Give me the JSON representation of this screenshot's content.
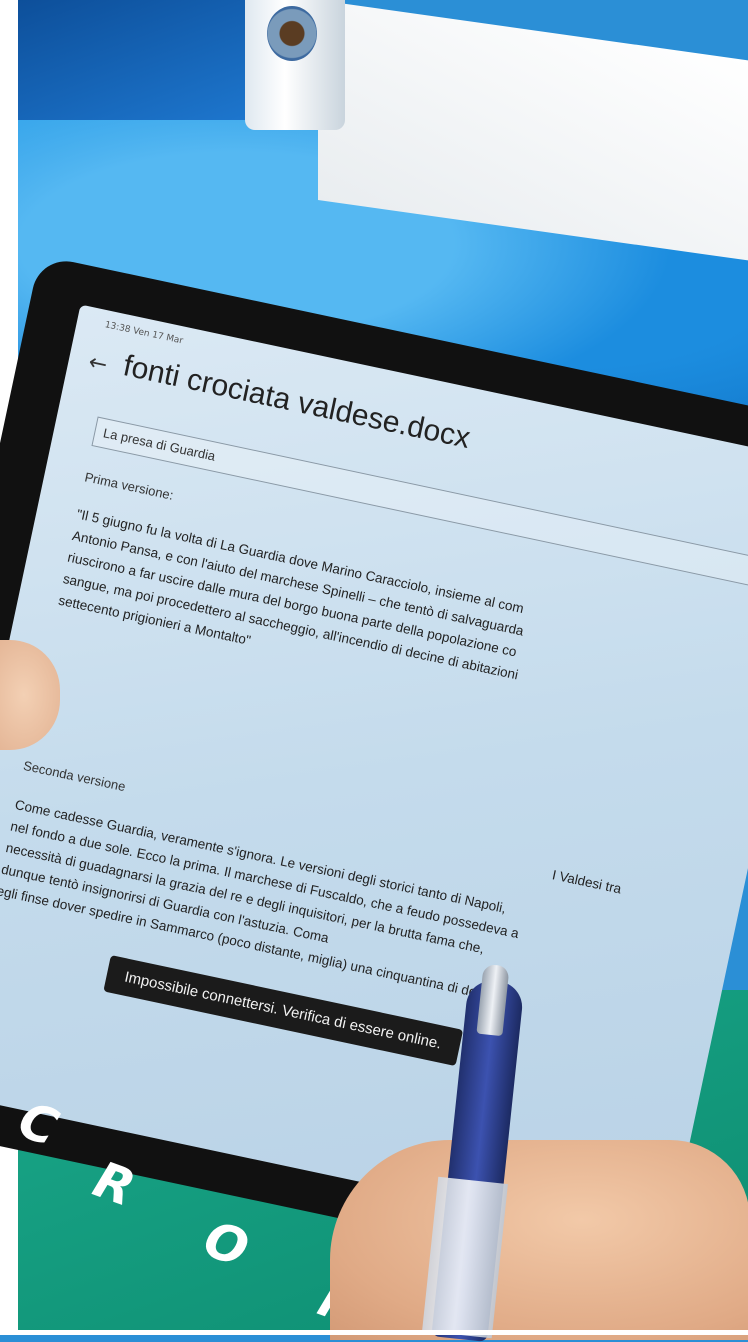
{
  "status_bar": "13:38 Ven 17 Mar",
  "document": {
    "title": "fonti crociata valdese.docx",
    "heading": "La presa di Guardia",
    "first_version_label": "Prima versione:",
    "first_version_lines": [
      "\"Il 5 giugno fu la volta di La Guardia dove Marino Caracciolo, insieme al com",
      "Antonio Pansa, e con l'aiuto del marchese Spinelli – che tentò di salvaguarda",
      "riuscirono a far uscire dalle mura del borgo buona parte della popolazione co",
      "sangue, ma poi procedettero al saccheggio, all'incendio di decine di abitazioni",
      "settecento prigionieri a Montalto\""
    ],
    "second_version_label": "Seconda versione",
    "second_version_caption": "I Valdesi tra",
    "second_version_lines": [
      "Come cadesse Guardia, veramente s'ignora. Le versioni degli storici tanto di Napoli,",
      "nel fondo a due sole. Ecco la prima. Il marchese di Fuscaldo, che a feudo possedeva a",
      "necessità di guadagnarsi la grazia del re e degli inquisitori, per la brutta fama che,",
      "dunque tentò insignorirsi di Guardia con l'astuzia. Coma",
      "egli finse dover spedire in Sammarco (poco distante, miglia) una cinquantina di del"
    ]
  },
  "toast": {
    "message": "Impossibile connettersi. Verifica di essere online."
  },
  "icons": {
    "back": "back-arrow-icon"
  }
}
